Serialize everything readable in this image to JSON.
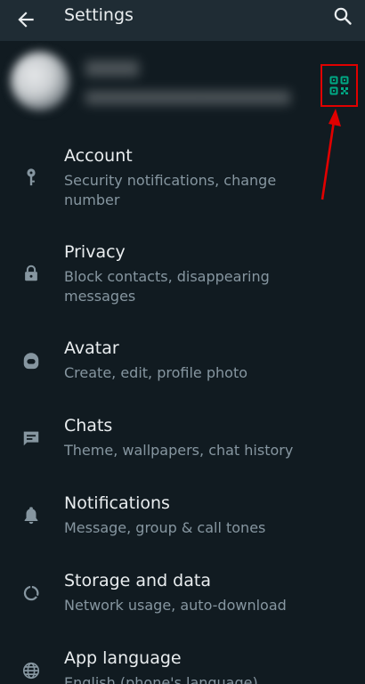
{
  "header": {
    "title": "Settings",
    "back_icon": "arrow-left-icon",
    "search_icon": "search-icon"
  },
  "profile": {
    "qr_icon": "qr-code-icon"
  },
  "menu": [
    {
      "label": "Account",
      "sub": "Security notifications, change number",
      "icon": "key-icon"
    },
    {
      "label": "Privacy",
      "sub": "Block contacts, disappearing messages",
      "icon": "lock-icon"
    },
    {
      "label": "Avatar",
      "sub": "Create, edit, profile photo",
      "icon": "avatar-icon"
    },
    {
      "label": "Chats",
      "sub": "Theme, wallpapers, chat history",
      "icon": "chat-icon"
    },
    {
      "label": "Notifications",
      "sub": "Message, group & call tones",
      "icon": "bell-icon"
    },
    {
      "label": "Storage and data",
      "sub": "Network usage, auto-download",
      "icon": "data-usage-icon"
    },
    {
      "label": "App language",
      "sub": "English (phone's language)",
      "icon": "globe-icon"
    }
  ],
  "colors": {
    "background": "#111b21",
    "header": "#1f2c34",
    "primary_text": "#e9edef",
    "secondary_text": "#8696a0",
    "accent": "#00a884",
    "highlight": "#e10000"
  }
}
